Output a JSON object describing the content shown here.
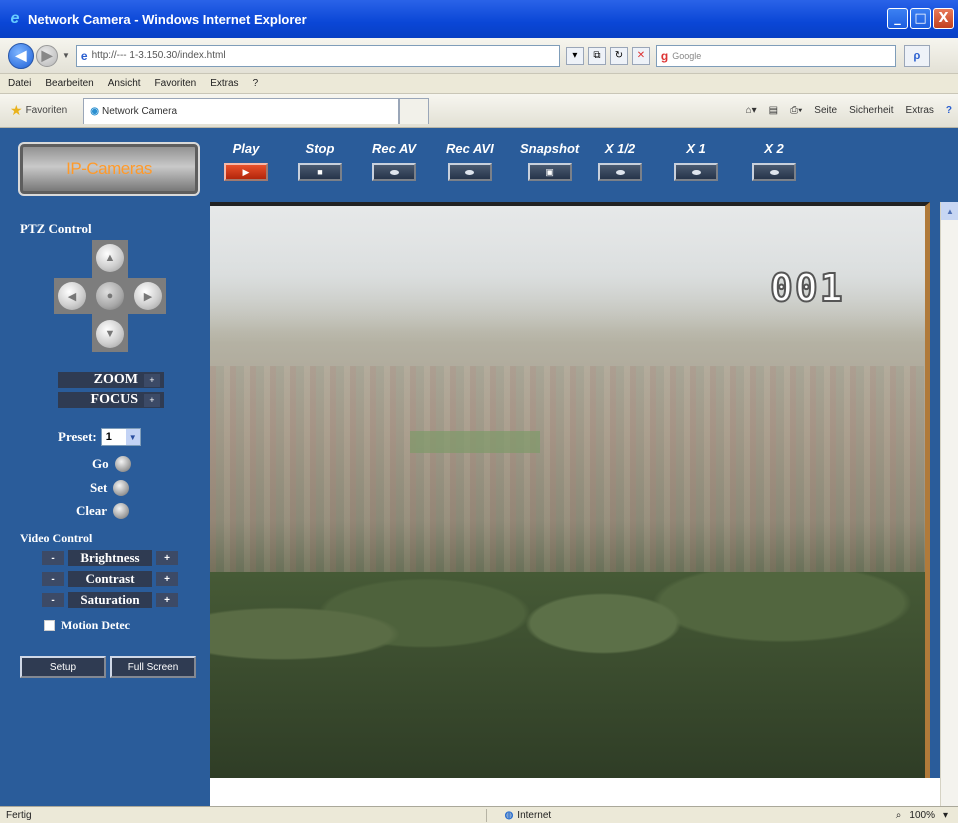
{
  "window": {
    "title": "Network Camera - Windows Internet Explorer",
    "minimize": "_",
    "maximize": "□",
    "close": "X"
  },
  "addressbar": {
    "url": "http://--- 1-3.150.30/index.html",
    "search_placeholder": "Google",
    "search_go": "ρ"
  },
  "menu": [
    "Datei",
    "Bearbeiten",
    "Ansicht",
    "Favoriten",
    "Extras",
    "?"
  ],
  "favbar": {
    "favorites_label": "Favoriten",
    "tab_label": "Network Camera",
    "commands": [
      "Seite",
      "Sicherheit",
      "Extras"
    ]
  },
  "logo": "IP-Cameras",
  "toolbar": [
    {
      "label": "Play",
      "active": true,
      "glyph": "▶"
    },
    {
      "label": "Stop",
      "active": false,
      "glyph": "■"
    },
    {
      "label": "Rec AV",
      "active": false,
      "glyph": ""
    },
    {
      "label": "Rec AVI",
      "active": false,
      "glyph": ""
    },
    {
      "label": "Snapshot",
      "active": false,
      "glyph": "▣"
    },
    {
      "label": "X 1/2",
      "active": false,
      "glyph": ""
    },
    {
      "label": "X 1",
      "active": false,
      "glyph": ""
    },
    {
      "label": "X 2",
      "active": false,
      "glyph": ""
    }
  ],
  "ptz": {
    "title": "PTZ Control",
    "zoom_label": "ZOOM",
    "focus_label": "FOCUS",
    "plus": "+"
  },
  "preset": {
    "label": "Preset:",
    "value": "1",
    "go": "Go",
    "set": "Set",
    "clear": "Clear"
  },
  "video_control": {
    "title": "Video Control",
    "brightness": "Brightness",
    "contrast": "Contrast",
    "saturation": "Saturation",
    "minus": "-",
    "plus": "+"
  },
  "motion_detect": "Motion Detec",
  "bottom_buttons": [
    "Setup",
    "Full Screen"
  ],
  "camera_id": "001",
  "status": {
    "left": "Fertig",
    "zone": "Internet",
    "zoom": "100%"
  }
}
